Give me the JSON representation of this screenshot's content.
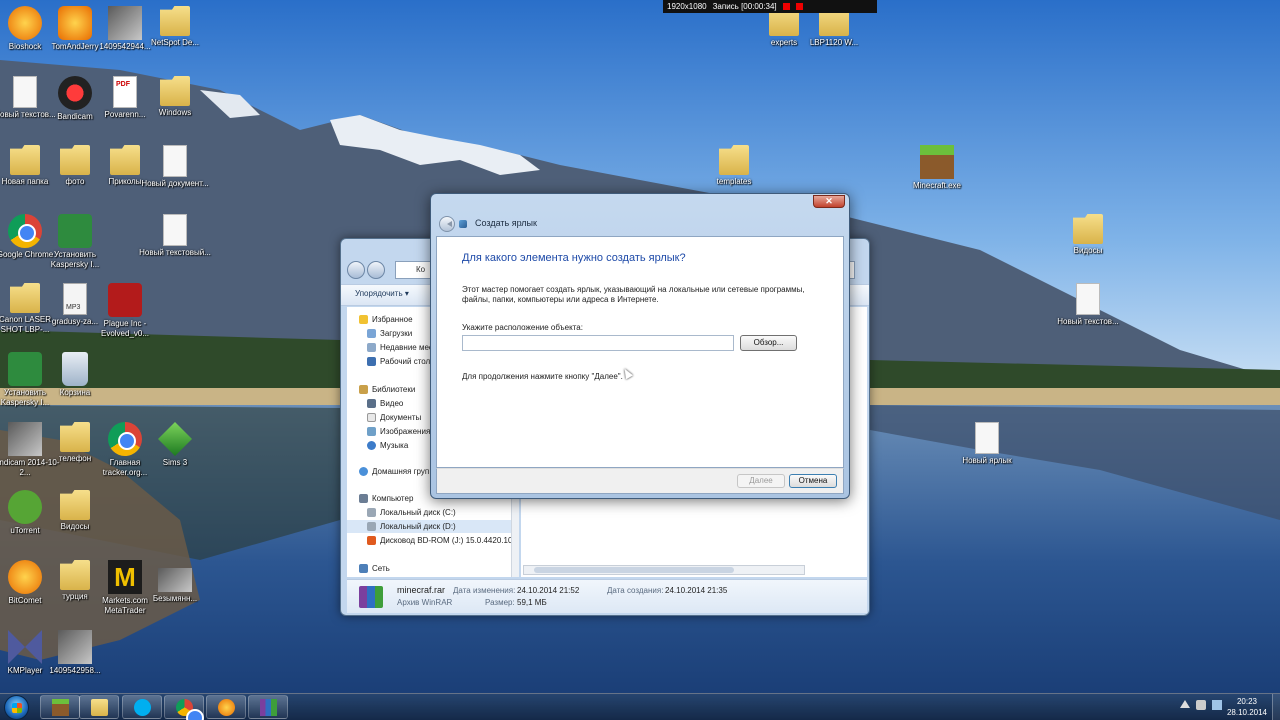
{
  "recorder": {
    "resolution": "1920x1080",
    "status": "Запись [00:00:34]"
  },
  "desktop_icons": [
    {
      "label": "Bioshock",
      "icon": "bioshock-icon"
    },
    {
      "label": "TomAndJerry",
      "icon": "tom-and-jerry-icon"
    },
    {
      "label": "1409542944...",
      "icon": "image-file-icon"
    },
    {
      "label": "NetSpot De...",
      "icon": "folder-icon"
    },
    {
      "label": "Новый текстов...",
      "icon": "text-document-icon"
    },
    {
      "label": "Bandicam",
      "icon": "bandicam-icon"
    },
    {
      "label": "Povarenn...",
      "icon": "pdf-icon"
    },
    {
      "label": "Windows",
      "icon": "folder-icon"
    },
    {
      "label": "Новая папка",
      "icon": "folder-icon"
    },
    {
      "label": "фото",
      "icon": "folder-icon"
    },
    {
      "label": "Приколы",
      "icon": "folder-icon"
    },
    {
      "label": "Новый документ...",
      "icon": "document-icon"
    },
    {
      "label": "Google Chrome",
      "icon": "chrome-icon"
    },
    {
      "label": "Установить Kaspersky I...",
      "icon": "kaspersky-icon"
    },
    {
      "label": "Новый текстовый...",
      "icon": "text-document-icon"
    },
    {
      "label": "Canon LASER SHOT LBP-...",
      "icon": "folder-icon"
    },
    {
      "label": "gradusy-za...",
      "icon": "mp3-file-icon"
    },
    {
      "label": "Plague Inc - Evolved_v0...",
      "icon": "plague-inc-icon"
    },
    {
      "label": "Установить Kaspersky I...",
      "icon": "kaspersky-icon"
    },
    {
      "label": "Корзина",
      "icon": "recycle-bin-icon"
    },
    {
      "label": "bandicam 2014-10-2...",
      "icon": "video-file-icon"
    },
    {
      "label": "телефон",
      "icon": "folder-icon"
    },
    {
      "label": "Главная tracker.org...",
      "icon": "chrome-icon"
    },
    {
      "label": "Sims 3",
      "icon": "sims-icon"
    },
    {
      "label": "uTorrent",
      "icon": "utorrent-icon"
    },
    {
      "label": "Видосы",
      "icon": "folder-icon"
    },
    {
      "label": "BitComet",
      "icon": "bitcomet-icon"
    },
    {
      "label": "турция",
      "icon": "folder-icon"
    },
    {
      "label": "Markets.com MetaTrader",
      "icon": "metatrader-icon"
    },
    {
      "label": "Безымянн...",
      "icon": "image-file-icon"
    },
    {
      "label": "KMPlayer",
      "icon": "kmplayer-icon"
    },
    {
      "label": "1409542958...",
      "icon": "image-file-icon"
    },
    {
      "label": "experts",
      "icon": "folder-icon"
    },
    {
      "label": "LBP1120 W...",
      "icon": "folder-icon"
    },
    {
      "label": "templates",
      "icon": "folder-icon"
    },
    {
      "label": "Minecraft.exe",
      "icon": "minecraft-icon"
    },
    {
      "label": "Видосы",
      "icon": "folder-icon"
    },
    {
      "label": "Новый текстов...",
      "icon": "text-document-icon"
    },
    {
      "label": "Новый ярлык",
      "icon": "shortcut-document-icon"
    }
  ],
  "explorer": {
    "path": "Ко",
    "organize_label": "Упорядочить ▾",
    "nav": {
      "favorites": "Избранное",
      "downloads": "Загрузки",
      "recent": "Недавние мес",
      "desktop": "Рабочий стол",
      "libraries": "Библиотеки",
      "video": "Видео",
      "documents": "Документы",
      "images": "Изображения",
      "music": "Музыка",
      "homegroup": "Домашняя груп",
      "computer": "Компьютер",
      "drive_c": "Локальный диск (C:)",
      "drive_d": "Локальный диск (D:)",
      "drive_j": "Дисковод BD-ROM (J:) 15.0.4420.1017",
      "network": "Сеть"
    },
    "details": {
      "filename": "minecraf.rar",
      "filetype": "Архив WinRAR",
      "modified_label": "Дата изменения:",
      "modified_value": "24.10.2014 21:52",
      "created_label": "Дата создания:",
      "created_value": "24.10.2014 21:35",
      "size_label": "Размер:",
      "size_value": "59,1 МБ"
    }
  },
  "wizard": {
    "title": "Создать ярлык",
    "question": "Для какого элемента нужно создать ярлык?",
    "description": "Этот мастер помогает создать ярлык, указывающий на локальные или сетевые программы, файлы, папки, компьютеры или адреса в Интернете.",
    "location_label": "Укажите расположение объекта:",
    "location_value": "",
    "browse_label": "Обзор...",
    "hint": "Для продолжения нажмите кнопку \"Далее\".",
    "next_label": "Далее",
    "cancel_label": "Отмена",
    "close_symbol": "✕"
  },
  "taskbar": {
    "apps": [
      "minecraft-icon",
      "explorer-icon",
      "skype-icon",
      "chrome-icon",
      "bitcomet-icon",
      "winrar-icon"
    ],
    "time": "20:23",
    "date": "28.10.2014"
  }
}
